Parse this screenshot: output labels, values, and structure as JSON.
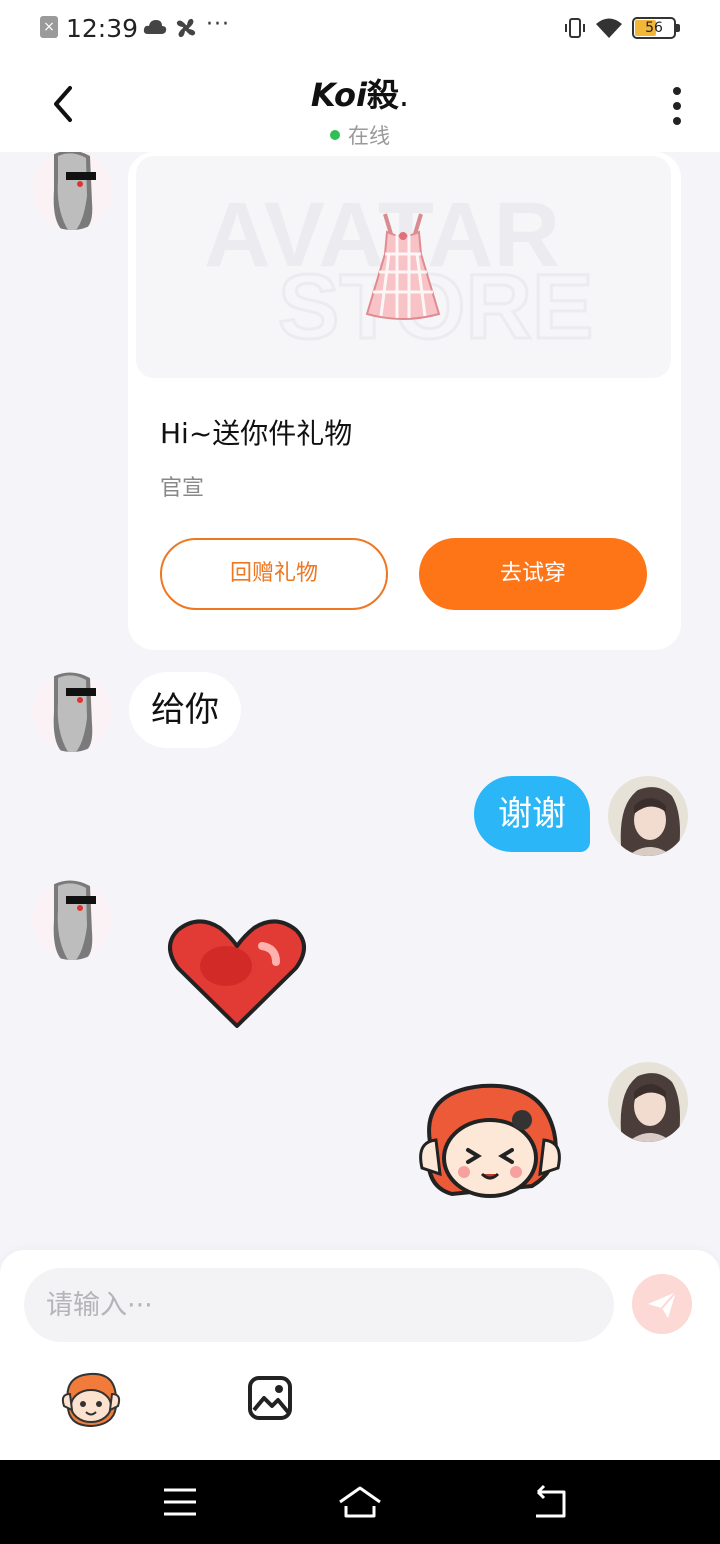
{
  "status_bar": {
    "time": "12:39",
    "dots": "···",
    "battery_level": 56,
    "battery_text": "56",
    "battery_color": "#f2b63b"
  },
  "header": {
    "title_latin": "Koi",
    "title_cjk": "殺",
    "title_tail": ".",
    "status": "在线",
    "status_color": "#2fbf55"
  },
  "gift_card": {
    "watermark_line1": "AVATAR",
    "watermark_line2": "STORE",
    "title": "Hi~送你件礼物",
    "subtitle": "官宣",
    "return_gift_label": "回赠礼物",
    "try_on_label": "去试穿",
    "accent": "#fe7518"
  },
  "messages": {
    "incoming_text": "给你",
    "outgoing_text": "谢谢",
    "outgoing_bubble_color": "#2bb6f7"
  },
  "input_bar": {
    "placeholder": "请输入···",
    "value": ""
  }
}
